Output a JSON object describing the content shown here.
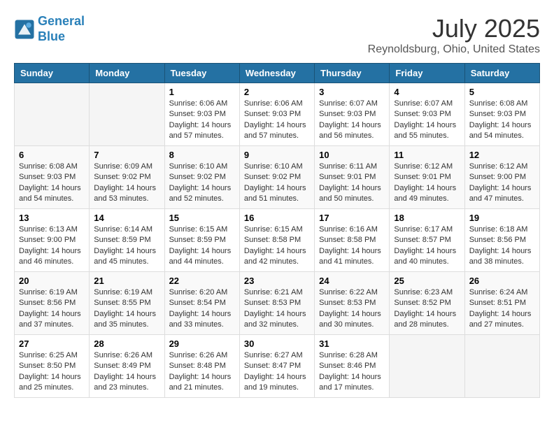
{
  "header": {
    "logo_line1": "General",
    "logo_line2": "Blue",
    "month_year": "July 2025",
    "location": "Reynoldsburg, Ohio, United States"
  },
  "weekdays": [
    "Sunday",
    "Monday",
    "Tuesday",
    "Wednesday",
    "Thursday",
    "Friday",
    "Saturday"
  ],
  "weeks": [
    [
      {
        "day": "",
        "info": ""
      },
      {
        "day": "",
        "info": ""
      },
      {
        "day": "1",
        "info": "Sunrise: 6:06 AM\nSunset: 9:03 PM\nDaylight: 14 hours\nand 57 minutes."
      },
      {
        "day": "2",
        "info": "Sunrise: 6:06 AM\nSunset: 9:03 PM\nDaylight: 14 hours\nand 57 minutes."
      },
      {
        "day": "3",
        "info": "Sunrise: 6:07 AM\nSunset: 9:03 PM\nDaylight: 14 hours\nand 56 minutes."
      },
      {
        "day": "4",
        "info": "Sunrise: 6:07 AM\nSunset: 9:03 PM\nDaylight: 14 hours\nand 55 minutes."
      },
      {
        "day": "5",
        "info": "Sunrise: 6:08 AM\nSunset: 9:03 PM\nDaylight: 14 hours\nand 54 minutes."
      }
    ],
    [
      {
        "day": "6",
        "info": "Sunrise: 6:08 AM\nSunset: 9:03 PM\nDaylight: 14 hours\nand 54 minutes."
      },
      {
        "day": "7",
        "info": "Sunrise: 6:09 AM\nSunset: 9:02 PM\nDaylight: 14 hours\nand 53 minutes."
      },
      {
        "day": "8",
        "info": "Sunrise: 6:10 AM\nSunset: 9:02 PM\nDaylight: 14 hours\nand 52 minutes."
      },
      {
        "day": "9",
        "info": "Sunrise: 6:10 AM\nSunset: 9:02 PM\nDaylight: 14 hours\nand 51 minutes."
      },
      {
        "day": "10",
        "info": "Sunrise: 6:11 AM\nSunset: 9:01 PM\nDaylight: 14 hours\nand 50 minutes."
      },
      {
        "day": "11",
        "info": "Sunrise: 6:12 AM\nSunset: 9:01 PM\nDaylight: 14 hours\nand 49 minutes."
      },
      {
        "day": "12",
        "info": "Sunrise: 6:12 AM\nSunset: 9:00 PM\nDaylight: 14 hours\nand 47 minutes."
      }
    ],
    [
      {
        "day": "13",
        "info": "Sunrise: 6:13 AM\nSunset: 9:00 PM\nDaylight: 14 hours\nand 46 minutes."
      },
      {
        "day": "14",
        "info": "Sunrise: 6:14 AM\nSunset: 8:59 PM\nDaylight: 14 hours\nand 45 minutes."
      },
      {
        "day": "15",
        "info": "Sunrise: 6:15 AM\nSunset: 8:59 PM\nDaylight: 14 hours\nand 44 minutes."
      },
      {
        "day": "16",
        "info": "Sunrise: 6:15 AM\nSunset: 8:58 PM\nDaylight: 14 hours\nand 42 minutes."
      },
      {
        "day": "17",
        "info": "Sunrise: 6:16 AM\nSunset: 8:58 PM\nDaylight: 14 hours\nand 41 minutes."
      },
      {
        "day": "18",
        "info": "Sunrise: 6:17 AM\nSunset: 8:57 PM\nDaylight: 14 hours\nand 40 minutes."
      },
      {
        "day": "19",
        "info": "Sunrise: 6:18 AM\nSunset: 8:56 PM\nDaylight: 14 hours\nand 38 minutes."
      }
    ],
    [
      {
        "day": "20",
        "info": "Sunrise: 6:19 AM\nSunset: 8:56 PM\nDaylight: 14 hours\nand 37 minutes."
      },
      {
        "day": "21",
        "info": "Sunrise: 6:19 AM\nSunset: 8:55 PM\nDaylight: 14 hours\nand 35 minutes."
      },
      {
        "day": "22",
        "info": "Sunrise: 6:20 AM\nSunset: 8:54 PM\nDaylight: 14 hours\nand 33 minutes."
      },
      {
        "day": "23",
        "info": "Sunrise: 6:21 AM\nSunset: 8:53 PM\nDaylight: 14 hours\nand 32 minutes."
      },
      {
        "day": "24",
        "info": "Sunrise: 6:22 AM\nSunset: 8:53 PM\nDaylight: 14 hours\nand 30 minutes."
      },
      {
        "day": "25",
        "info": "Sunrise: 6:23 AM\nSunset: 8:52 PM\nDaylight: 14 hours\nand 28 minutes."
      },
      {
        "day": "26",
        "info": "Sunrise: 6:24 AM\nSunset: 8:51 PM\nDaylight: 14 hours\nand 27 minutes."
      }
    ],
    [
      {
        "day": "27",
        "info": "Sunrise: 6:25 AM\nSunset: 8:50 PM\nDaylight: 14 hours\nand 25 minutes."
      },
      {
        "day": "28",
        "info": "Sunrise: 6:26 AM\nSunset: 8:49 PM\nDaylight: 14 hours\nand 23 minutes."
      },
      {
        "day": "29",
        "info": "Sunrise: 6:26 AM\nSunset: 8:48 PM\nDaylight: 14 hours\nand 21 minutes."
      },
      {
        "day": "30",
        "info": "Sunrise: 6:27 AM\nSunset: 8:47 PM\nDaylight: 14 hours\nand 19 minutes."
      },
      {
        "day": "31",
        "info": "Sunrise: 6:28 AM\nSunset: 8:46 PM\nDaylight: 14 hours\nand 17 minutes."
      },
      {
        "day": "",
        "info": ""
      },
      {
        "day": "",
        "info": ""
      }
    ]
  ]
}
